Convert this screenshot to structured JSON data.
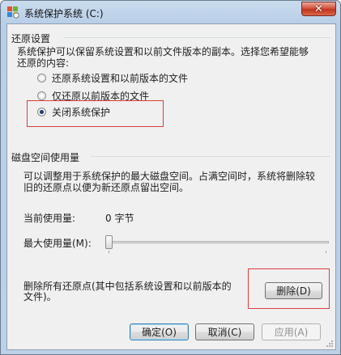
{
  "window": {
    "title": "系统保护系统 (C:)"
  },
  "restore_settings": {
    "group_title": "还原设置",
    "description_line1": "系统保护可以保留系统设置和以前文件版本的副本。选择您希望能够",
    "description_line2": "还原的内容:",
    "options": [
      {
        "label": "还原系统设置和以前版本的文件",
        "checked": false
      },
      {
        "label": "仅还原以前版本的文件",
        "checked": false
      },
      {
        "label": "关闭系统保护",
        "checked": true
      }
    ]
  },
  "disk_space": {
    "group_title": "磁盘空间使用量",
    "description_line1": "可以调整用于系统保护的最大磁盘空间。占满空间时，系统将删除较",
    "description_line2": "旧的还原点以便为新还原点留出空间。",
    "current_usage_label": "当前使用量:",
    "current_usage_value": "0 字节",
    "max_usage_label": "最大使用量(M):",
    "max_usage_fraction": 0
  },
  "delete_section": {
    "text_line1": "删除所有还原点(其中包括系统设置和以前版本的",
    "text_line2": "文件)。",
    "button_label": "删除(D)"
  },
  "footer": {
    "ok_label": "确定(O)",
    "cancel_label": "取消(C)",
    "apply_label": "应用(A)"
  },
  "colors": {
    "highlight_box": "#d93e3e",
    "accent": "#3c7fb1"
  }
}
